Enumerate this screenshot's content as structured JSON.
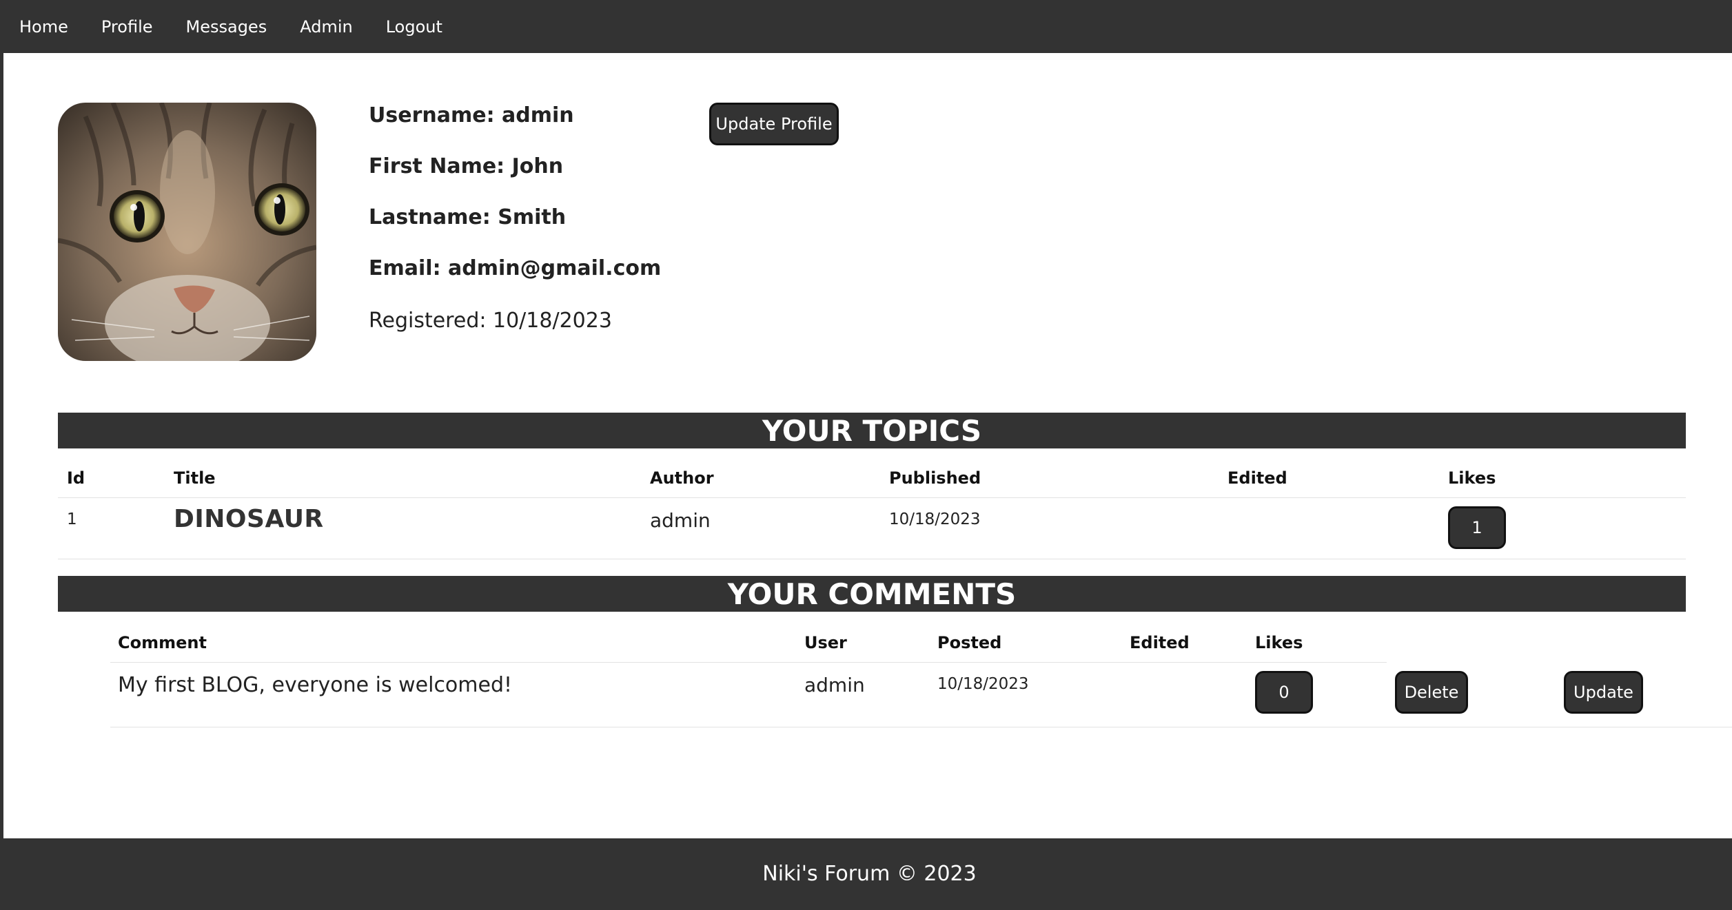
{
  "nav": {
    "items": [
      {
        "label": "Home"
      },
      {
        "label": "Profile"
      },
      {
        "label": "Messages"
      },
      {
        "label": "Admin"
      },
      {
        "label": "Logout"
      }
    ]
  },
  "profile": {
    "avatar_icon": "cat-photo",
    "username": "Username: admin",
    "first_name": "First Name: John",
    "last_name": "Lastname: Smith",
    "email": "Email: admin@gmail.com",
    "registered": "Registered: 10/18/2023",
    "update_button": "Update Profile"
  },
  "topics": {
    "heading": "YOUR TOPICS",
    "columns": [
      "Id",
      "Title",
      "Author",
      "Published",
      "Edited",
      "Likes"
    ],
    "rows": [
      {
        "id": "1",
        "title": "DINOSAUR",
        "author": "admin",
        "published": "10/18/2023",
        "edited": "",
        "likes": "1"
      }
    ]
  },
  "comments": {
    "heading": "YOUR COMMENTS",
    "columns": [
      "Comment",
      "User",
      "Posted",
      "Edited",
      "Likes"
    ],
    "rows": [
      {
        "comment": "My first BLOG, everyone is welcomed!",
        "user": "admin",
        "posted": "10/18/2023",
        "edited": "",
        "likes": "0",
        "delete_label": "Delete",
        "update_label": "Update"
      }
    ]
  },
  "footer": {
    "text": "Niki's Forum © 2023"
  },
  "colors": {
    "bar": "#333333",
    "text": "#222222",
    "button": "#333333"
  }
}
